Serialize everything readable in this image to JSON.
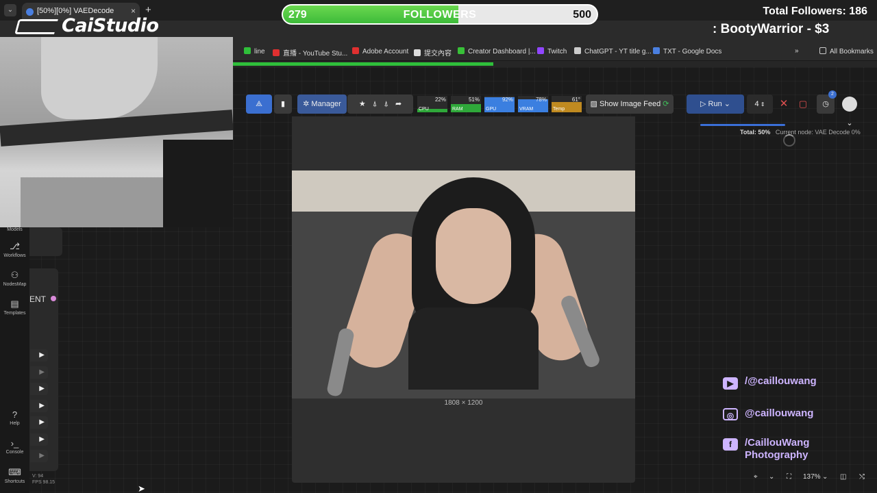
{
  "browser": {
    "tab_title": "[50%][0%] VAEDecode",
    "new_tab": "+",
    "close": "×",
    "bookmarks": [
      {
        "label": "line",
        "color": "#2fbf3a"
      },
      {
        "label": "直播 - YouTube Stu...",
        "color": "#e03030"
      },
      {
        "label": "Adobe Account",
        "color": "#e03030"
      },
      {
        "label": "提交內容",
        "color": "#dddddd"
      },
      {
        "label": "Creator Dashboard |...",
        "color": "#38c038"
      },
      {
        "label": "Twitch",
        "color": "#9146ff"
      },
      {
        "label": "ChatGPT - YT title g...",
        "color": "#cccccc"
      },
      {
        "label": "TXT - Google Docs",
        "color": "#4a7fe0"
      }
    ],
    "more": "»",
    "all_bookmarks": "All Bookmarks"
  },
  "overlay": {
    "logo": "CaiStudio",
    "followers_current": "279",
    "followers_label": "FOLLOWERS",
    "followers_goal": "500",
    "followers_progress": 0.558,
    "total_followers": "Total Followers: 186",
    "ticker": ": BootyWarrior - $3"
  },
  "sidebar": {
    "models": "Models",
    "workflows": "Workflows",
    "nodesmap": "NodesMap",
    "templates": "Templates",
    "help": "Help",
    "console": "Console",
    "shortcuts": "Shortcuts",
    "node_fragment": "ENT",
    "version": "V: 94",
    "fps": "FPS 98.15"
  },
  "toolbar": {
    "manager": "Manager",
    "stats": [
      {
        "name": "CPU",
        "pct": "22%",
        "level": 0.22,
        "color": "#2fa83a"
      },
      {
        "name": "RAM",
        "pct": "51%",
        "level": 0.51,
        "color": "#2fa83a"
      },
      {
        "name": "GPU",
        "pct": "92%",
        "level": 0.92,
        "color": "#3b7fe0"
      },
      {
        "name": "VRAM",
        "pct": "78%",
        "level": 0.78,
        "color": "#3b7fe0"
      },
      {
        "name": "Temp",
        "pct": "61°",
        "level": 0.61,
        "color": "#c08a20"
      }
    ],
    "show_image_feed": "Show Image Feed",
    "run": "Run",
    "batch_count": "4",
    "queue_badge": "2"
  },
  "progress": {
    "total_label": "Total:",
    "total_value": "50%",
    "current_node": "Current node: VAE Decode 0%",
    "level": 0.5
  },
  "image_feed": {
    "dimensions": "1808 × 1200"
  },
  "socials": [
    {
      "icon": "youtube-icon",
      "label": "/@caillouwang"
    },
    {
      "icon": "instagram-icon",
      "label": "@caillouwang"
    },
    {
      "icon": "facebook-icon",
      "label": "/CaillouWang\nPhotography"
    }
  ],
  "canvas_controls": {
    "zoom": "137%"
  }
}
